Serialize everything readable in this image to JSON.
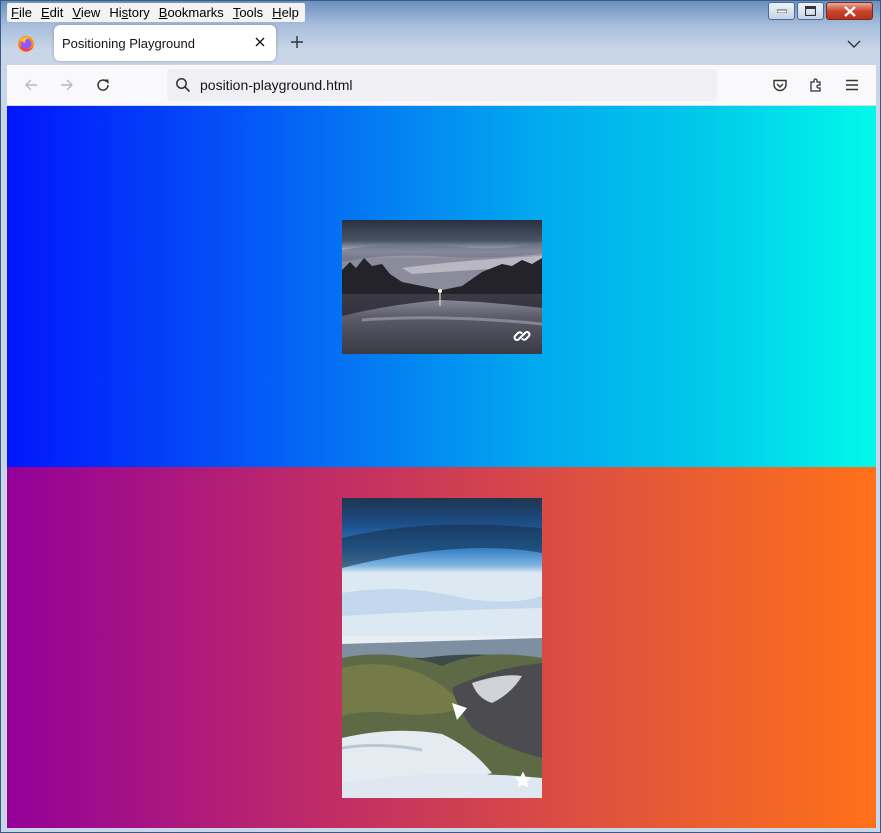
{
  "browser": {
    "menu": [
      "File",
      "Edit",
      "View",
      "History",
      "Bookmarks",
      "Tools",
      "Help"
    ],
    "menu_underline_index": [
      0,
      0,
      0,
      2,
      0,
      0,
      0
    ],
    "tab_title": "Positioning Playground",
    "url": "position-playground.html"
  },
  "page": {
    "section1": {
      "gradient": [
        "#0216fb",
        "#02f9e9"
      ],
      "card": {
        "image": "dusk-lake-photo",
        "icon": "link-icon"
      }
    },
    "section2": {
      "gradient": [
        "#940099",
        "#ff7118"
      ],
      "card": {
        "image": "mountain-photo",
        "icon": "star-icon"
      }
    }
  }
}
